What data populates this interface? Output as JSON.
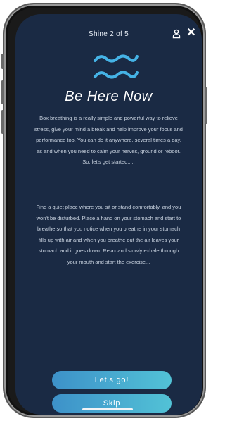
{
  "header": {
    "title": "Shine 2 of 5"
  },
  "icons": {
    "profile": "person-icon",
    "close": "close-icon",
    "close_glyph": "✕",
    "logo": "waves-icon"
  },
  "main": {
    "title": "Be Here Now",
    "paragraph_1": "Box breathing is a really simple and powerful way to relieve stress, give your mind a break and help improve your focus and performance too. You can do it anywhere, several times a day, as and when you need to calm your nerves, ground or reboot. So, let's get started.....",
    "paragraph_2": "Find a quiet place where you sit or stand comfortably, and you won't be disturbed. Place a hand on your stomach and start to breathe so that you notice when you breathe in your stomach fills up with air and when you breathe out the air leaves your stomach and it goes down. Relax and slowly exhale through your mouth and start the exercise..."
  },
  "actions": {
    "primary_label": "Let's go!",
    "secondary_label": "Skip"
  },
  "colors": {
    "background": "#1a2a44",
    "accent_start": "#3d91c9",
    "accent_end": "#52c2d6",
    "wave": "#45b3e6"
  }
}
